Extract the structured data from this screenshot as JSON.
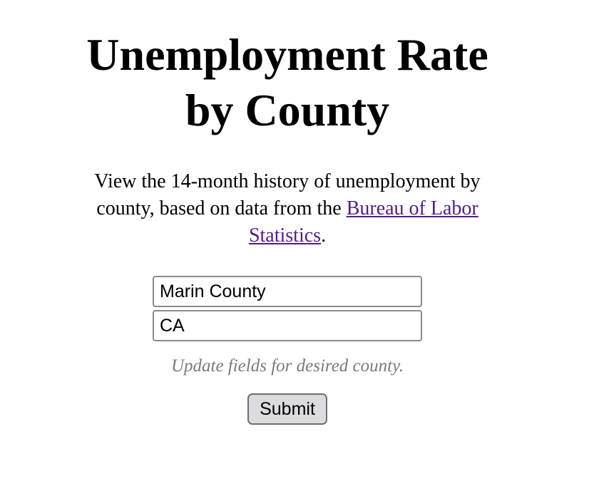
{
  "header": {
    "title_line1": "Unemployment Rate",
    "title_line2": "by County"
  },
  "intro": {
    "text_before": "View the 14-month history of unemployment by county, based on data from the ",
    "link_text": "Bureau of Labor Statistics",
    "text_after": "."
  },
  "form": {
    "county_value": "Marin County",
    "state_value": "CA",
    "hint": "Update fields for desired county.",
    "submit_label": "Submit"
  },
  "colors": {
    "link": "#551a8b",
    "hint_text": "#7a7a7a",
    "button_bg": "#dcdce0"
  }
}
